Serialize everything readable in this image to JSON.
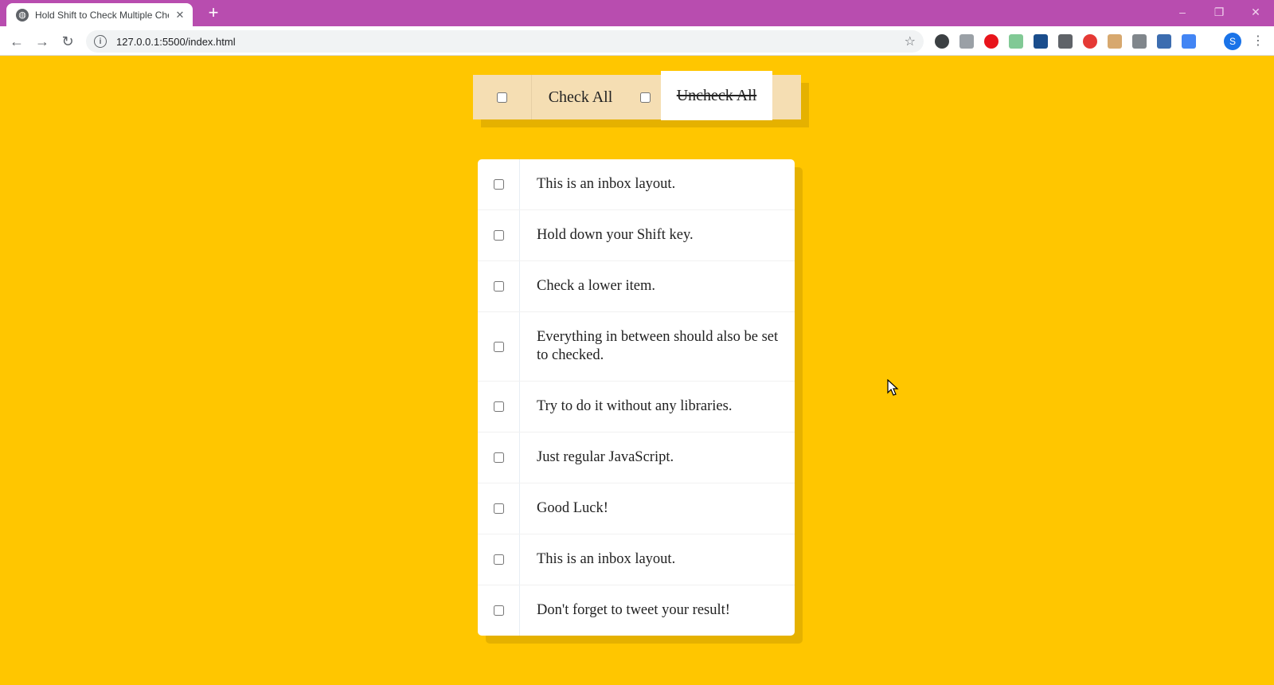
{
  "browser": {
    "tab_title": "Hold Shift to Check Multiple Che",
    "tab_close": "✕",
    "new_tab": "+",
    "url": "127.0.0.1:5500/index.html",
    "profile_initial": "S",
    "window_controls": [
      "–",
      "❐",
      "✕"
    ],
    "extension_icons": [
      "ext-cloud-icon",
      "ext-w-icon",
      "ext-opera-icon",
      "ext-mail-icon",
      "ext-ut-icon",
      "ext-facebook-icon",
      "ext-red-icon",
      "ext-box-icon",
      "ext-camera-icon",
      "ext-monitor-icon",
      "ext-pen-icon"
    ]
  },
  "controls": {
    "check_all_label": "Check All",
    "uncheck_all_label": "Uncheck All"
  },
  "items": [
    {
      "text": "This is an inbox layout.",
      "checked": false
    },
    {
      "text": "Hold down your Shift key.",
      "checked": false
    },
    {
      "text": "Check a lower item.",
      "checked": false
    },
    {
      "text": "Everything in between should also be set to checked.",
      "checked": false
    },
    {
      "text": "Try to do it without any libraries.",
      "checked": false
    },
    {
      "text": "Just regular JavaScript.",
      "checked": false
    },
    {
      "text": "Good Luck!",
      "checked": false
    },
    {
      "text": "This is an inbox layout.",
      "checked": false
    },
    {
      "text": "Don't forget to tweet your result!",
      "checked": false
    }
  ],
  "colors": {
    "page_background": "#ffc600",
    "controls_background": "#f5deb3",
    "tabstrip": "#b84daf"
  }
}
